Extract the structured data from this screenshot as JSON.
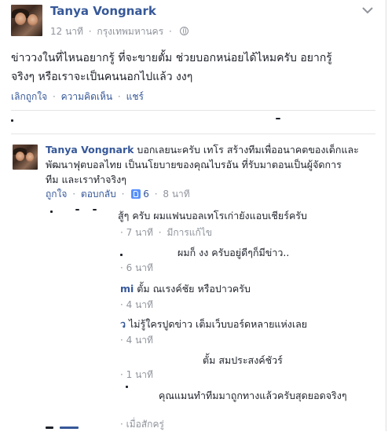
{
  "post": {
    "author": "Tanya Vongnark",
    "time": "12 นาที",
    "location": "กรุงเทพมหานคร",
    "text_line1": "ข่าววงในที่ไหนอยากรู้ ที่จะขายตั้ม ช่วยบอกหน่อยได้ไหมครับ อยากรู้",
    "text_line2": "จริงๆ หรือเราจะเป็นคนนอกไปแล้ว งงๆ",
    "actions": {
      "unlike": "เลิกถูกใจ",
      "comment": "ความคิดเห็น",
      "share": "แชร์"
    }
  },
  "comment": {
    "author": "Tanya Vongnark",
    "text_line1": "บอกเลยนะครับ เทโร สร้างทีมเพื่ออนาคตของเด็กและ",
    "text_line2": "พัฒนาฟุตบอลไทย เป็นนโยบายของคุณไบรอัน ที่รับมาตอนเป็นผู้จัดการ",
    "text_line3": "ทีม และเราทำจริงๆ",
    "like": "ถูกใจ",
    "reply": "ตอบกลับ",
    "like_count": "6",
    "time": "8 นาที"
  },
  "replies": [
    {
      "text": "สู้ๆ ครับ ผมแฟนบอลเทโรเก่ายังแอบเชียร์ครับ",
      "meta": "7 นาที",
      "edited": "มีการแก้ไข"
    },
    {
      "text": "ผมก็ งง ครับอยู่ดีๆก็มีข่าว..",
      "meta": "6 นาที"
    },
    {
      "name_frag": "mi",
      "text": "ตั้ม ณเรงค์ชัย หรือปาวครับ",
      "meta": "4 นาที"
    },
    {
      "name_frag": "ว",
      "text": "ไม่รู้ใครปูดข่าว เต็มเว็บบอร์ดหลายแห่งเลย",
      "meta": "4 นาที"
    },
    {
      "text": "ตั้ม สมประสงค์ชัวร์",
      "meta": "1 นาที"
    },
    {
      "text": "คุณแมนทำทีมมาถูกทางแล้วครับสุดยอดจริงๆ",
      "meta": "เมื่อสักครู่"
    }
  ]
}
